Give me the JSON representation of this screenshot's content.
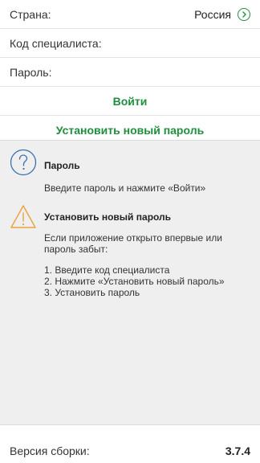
{
  "form": {
    "country_label": "Страна:",
    "country_value": "Россия",
    "specialist_label": "Код специалиста:",
    "specialist_value": "",
    "password_label": "Пароль:",
    "password_value": ""
  },
  "actions": {
    "login_label": "Войти",
    "set_password_label": "Установить новый пароль"
  },
  "help": {
    "password": {
      "title": "Пароль",
      "text": "Введите пароль и нажмите «Войти»"
    },
    "new_password": {
      "title": "Установить новый пароль",
      "intro": "Если приложение открыто впервые или пароль забыт:",
      "steps": [
        "1. Введите код специалиста",
        "2. Нажмите «Установить новый пароль»",
        "3. Установить пароль"
      ]
    }
  },
  "footer": {
    "build_label": "Версия сборки:",
    "build_value": "3.7.4"
  },
  "colors": {
    "accent": "#1f8f3e",
    "question_icon": "#3a6fb0",
    "warning_icon": "#e8a33c",
    "panel_bg": "#efefef"
  },
  "icons": {
    "country_select": "chevron-right-circle-icon",
    "password_help": "question-circle-icon",
    "new_password_help": "warning-triangle-icon"
  }
}
